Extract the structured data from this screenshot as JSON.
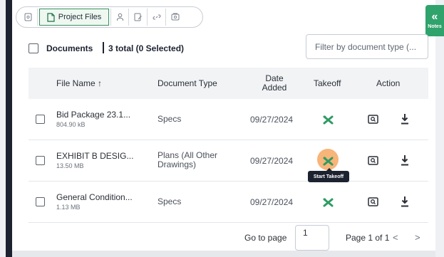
{
  "tabs": [
    {
      "icon": "document-icon",
      "label": ""
    },
    {
      "icon": "file-icon",
      "label": "Project Files",
      "active": true
    },
    {
      "icon": "people-icon",
      "label": ""
    },
    {
      "icon": "edit-document-icon",
      "label": ""
    },
    {
      "icon": "link-icon",
      "label": ""
    },
    {
      "icon": "photo-icon",
      "label": ""
    }
  ],
  "notes": {
    "chevron": "«",
    "label": "Notes"
  },
  "header": {
    "title": "Documents",
    "count": "3 total (0 Selected)",
    "filter_placeholder": "Filter by document type (..."
  },
  "table": {
    "columns": {
      "file_name": "File Name ↑",
      "document_type": "Document Type",
      "date_added_1": "Date",
      "date_added_2": "Added",
      "takeoff": "Takeoff",
      "action": "Action"
    },
    "rows": [
      {
        "name": "Bid Package 23.1...",
        "size": "804.90 kB",
        "type_1": "Specs",
        "type_2": "",
        "date": "09/27/2024"
      },
      {
        "name": "EXHIBIT B DESIG...",
        "size": "13.50 MB",
        "type_1": "Plans (All Other",
        "type_2": "Drawings)",
        "date": "09/27/2024"
      },
      {
        "name": "General Condition...",
        "size": "1.13 MB",
        "type_1": "Specs",
        "type_2": "",
        "date": "09/27/2024"
      }
    ]
  },
  "tooltip": "Start Takeoff",
  "pagination": {
    "goto_label": "Go to page",
    "page_value": "1",
    "page_info": "Page 1 of 1",
    "prev": "<",
    "next": ">"
  },
  "colors": {
    "accent_green": "#2fa36b",
    "takeoff_icon": "#2e9b63",
    "hover_ring": "#f6a862",
    "dark_frame": "#1d2230"
  }
}
